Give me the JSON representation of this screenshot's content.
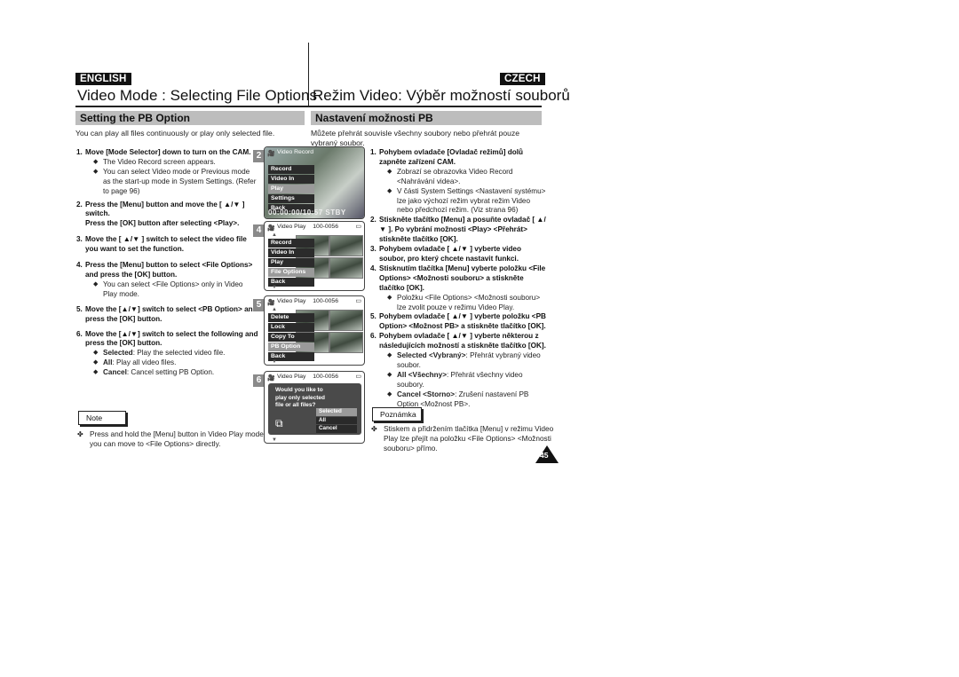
{
  "english": {
    "lang_label": "ENGLISH",
    "title": "Video Mode : Selecting File Options",
    "section": "Setting the PB Option",
    "intro": "You can play all files continuously or play only selected file.",
    "steps": [
      {
        "num": "1.",
        "text": "Move [Mode Selector] down to turn on the CAM.",
        "bullets": [
          {
            "bold": "",
            "text": "The Video Record screen appears."
          },
          {
            "bold": "",
            "text": "You can select Video mode or Previous mode as the start-up mode in System Settings. (Refer to page 96)"
          }
        ]
      },
      {
        "num": "2.",
        "text": "Press the [Menu] button and move the [ ▲/▼ ] switch.",
        "text2": "Press the [OK] button after selecting <Play>.",
        "bullets": []
      },
      {
        "num": "3.",
        "text": "Move the [ ▲/▼ ] switch to select the video file you want to set the function.",
        "bullets": []
      },
      {
        "num": "4.",
        "text": "Press the [Menu] button to select <File Options> and press the [OK] button.",
        "bullets": [
          {
            "bold": "",
            "text": "You can select <File Options> only in Video Play mode."
          }
        ]
      },
      {
        "num": "5.",
        "text": "Move the [▲/▼] switch to select <PB Option> and press the [OK] button.",
        "bullets": []
      },
      {
        "num": "6.",
        "text": "Move the [▲/▼] switch to select the following and press the [OK] button.",
        "bullets": [
          {
            "bold": "Selected",
            "text": ": Play the selected video file."
          },
          {
            "bold": "All",
            "text": ": Play all video files."
          },
          {
            "bold": "Cancel",
            "text": ": Cancel setting PB Option."
          }
        ]
      }
    ],
    "note_label": "Note",
    "note_text": "Press and hold the [Menu] button in Video Play mode, you can move to <File Options> directly."
  },
  "czech": {
    "lang_label": "CZECH",
    "title": "Režim Video: Výběr možností souborů",
    "section": "Nastavení možnosti PB",
    "intro": "Můžete přehrát souvisle všechny soubory nebo přehrát pouze vybraný soubor.",
    "steps": [
      {
        "num": "1.",
        "text": "Pohybem ovladače [Ovladač režimů] dolů zapněte zařízení CAM.",
        "bullets": [
          {
            "bold": "",
            "text": "Zobrazí se obrazovka Video Record <Nahrávání videa>."
          },
          {
            "bold": "",
            "text": "V části System Settings <Nastavení systému> lze jako výchozí režim vybrat režim Video nebo předchozí režim. (Viz strana 96)"
          }
        ]
      },
      {
        "num": "2.",
        "text": "Stiskněte tlačítko [Menu] a posuňte ovladač [ ▲/▼ ]. Po vybrání možnosti <Play> <Přehrát> stiskněte tlačítko [OK].",
        "bullets": []
      },
      {
        "num": "3.",
        "text": "Pohybem ovladače [ ▲/▼ ] vyberte video soubor, pro který chcete nastavit funkci.",
        "bullets": []
      },
      {
        "num": "4.",
        "text": "Stisknutím tlačítka [Menu] vyberte položku <File Options> <Možnosti souboru> a stiskněte tlačítko [OK].",
        "bullets": [
          {
            "bold": "",
            "text": "Položku <File Options> <Možnosti souboru> lze zvolit pouze v režimu Video Play."
          }
        ]
      },
      {
        "num": "5.",
        "text": "Pohybem ovladače [ ▲/▼ ] vyberte položku <PB Option> <Možnost PB> a stiskněte tlačítko [OK].",
        "bullets": []
      },
      {
        "num": "6.",
        "text": "Pohybem ovladače [ ▲/▼ ] vyberte některou z následujících možností a stiskněte tlačítko [OK].",
        "bullets": [
          {
            "bold": "Selected <Vybraný>",
            "text": ": Přehrát vybraný video soubor."
          },
          {
            "bold": "All <Všechny>",
            "text": ": Přehrát všechny video soubory."
          },
          {
            "bold": "Cancel <Storno>",
            "text": ": Zrušení nastavení PB Option <Možnost PB>."
          }
        ]
      }
    ],
    "note_label": "Poznámka",
    "note_text": "Stiskem a přidržením tlačítka [Menu] v režimu Video Play lze přejít na položku <File Options> <Možnosti souboru> přímo."
  },
  "screens": [
    {
      "step": "2",
      "title": "Video Record",
      "counter": "",
      "menu": [
        "Record",
        "Video In",
        "Play",
        "Settings",
        "Back"
      ],
      "selected": 2,
      "bottom": "00:00:00/10:57  STBY"
    },
    {
      "step": "4",
      "title": "Video Play",
      "counter": "100-0056",
      "menu": [
        "Record",
        "Video In",
        "Play",
        "File Options",
        "Back"
      ],
      "selected": 3
    },
    {
      "step": "5",
      "title": "Video Play",
      "counter": "100-0056",
      "menu": [
        "Delete",
        "Lock",
        "Copy To",
        "PB Option",
        "Back"
      ],
      "selected": 3
    },
    {
      "step": "6",
      "title": "Video Play",
      "counter": "100-0056",
      "dialog": "Would you like to play only selected file or all files?",
      "options": [
        "Selected",
        "All",
        "Cancel"
      ],
      "selected": 0
    }
  ],
  "icons": {
    "camera": "🎥",
    "battery": "▭",
    "card": "◨",
    "up": "▲",
    "down": "▼",
    "bullet": "◆",
    "note": "✤",
    "file": "⧉"
  },
  "page_number": "45"
}
